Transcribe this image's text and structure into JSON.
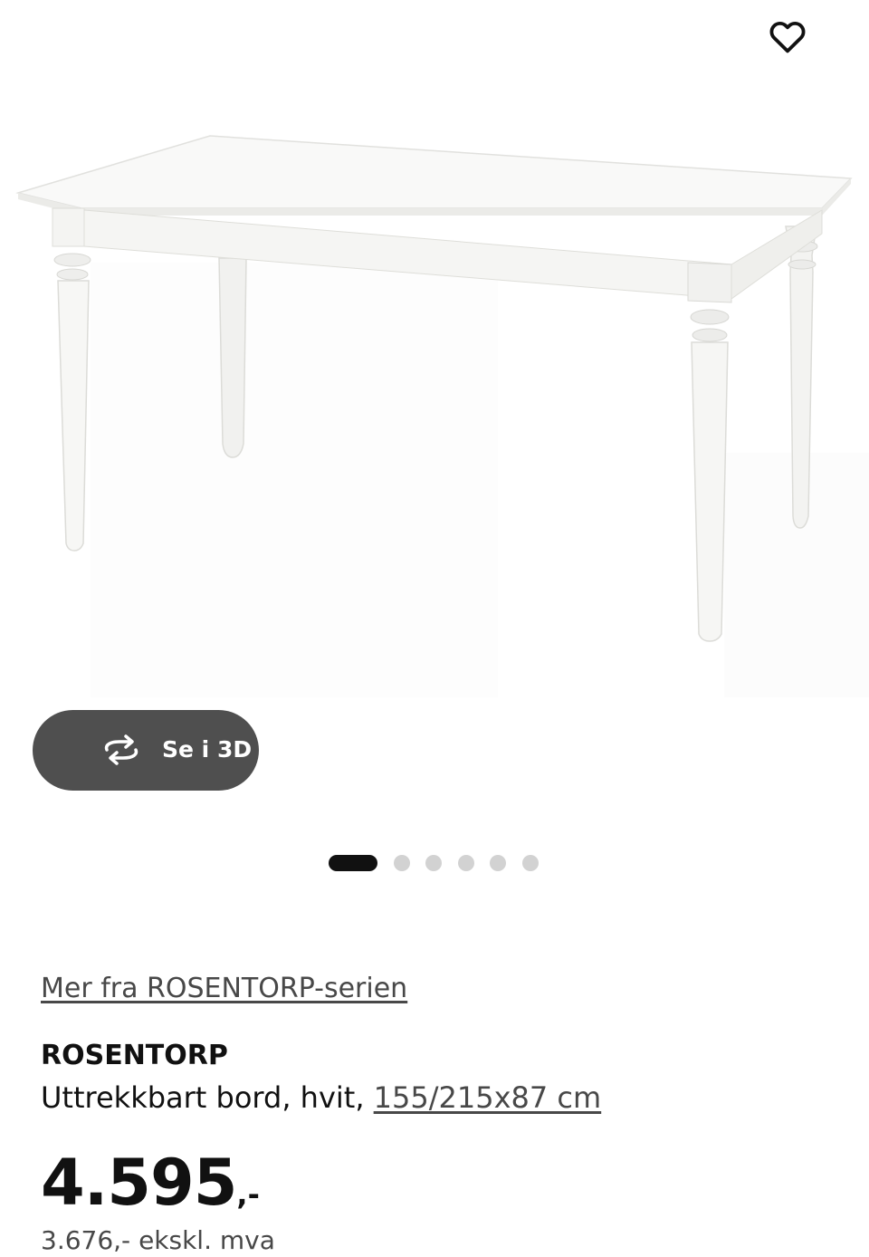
{
  "product_image": {
    "alt": "ROSENTORP Uttrekkbart bord, hvit"
  },
  "favourite": {
    "icon": "heart-outline-icon"
  },
  "view_3d": {
    "label": "Se i 3D",
    "icon": "rotate-3d-icon"
  },
  "carousel": {
    "total": 6,
    "active_index": 0
  },
  "series_link": {
    "label": "Mer fra ROSENTORP-serien"
  },
  "product": {
    "name": "ROSENTORP",
    "description_prefix": "Uttrekkbart bord, hvit, ",
    "size": "155/215x87 cm"
  },
  "price": {
    "integer": "4.595",
    "decimal": ",-"
  },
  "sub_line": {
    "text": "3.676,- ekskl. mva"
  },
  "colors": {
    "button_bg": "#4f4f4f",
    "dot_active": "#111111",
    "dot_inactive": "#d2d2d2",
    "link": "#484848"
  }
}
